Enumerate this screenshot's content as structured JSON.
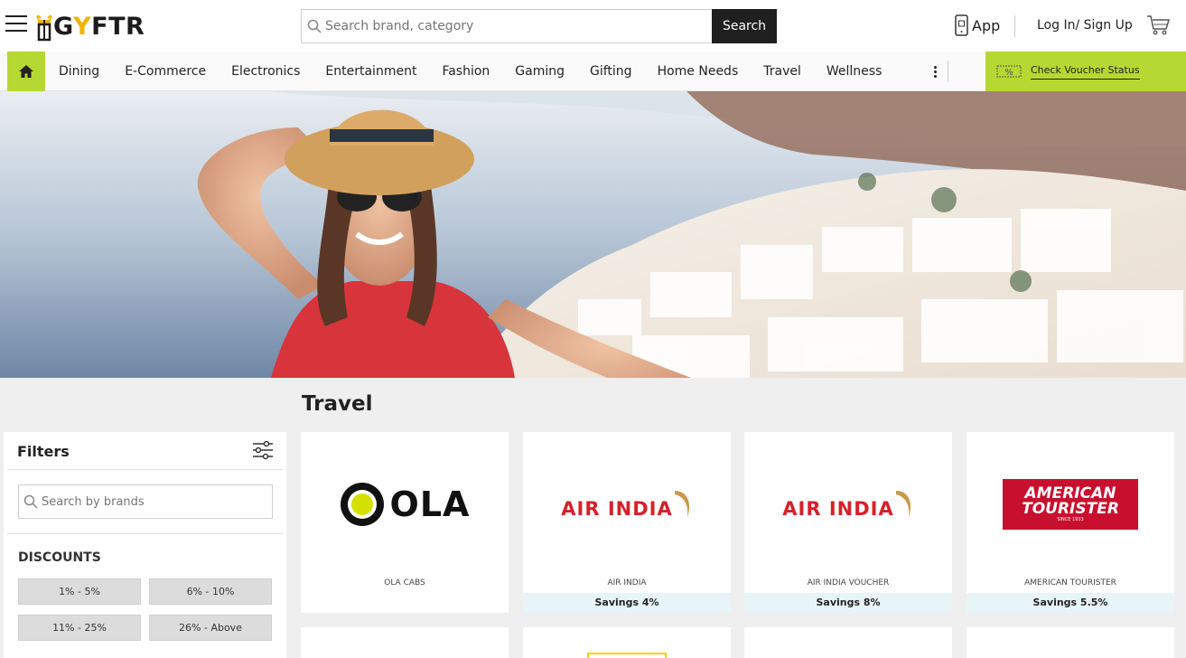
{
  "header": {
    "logo_text_left": "G",
    "logo_text_y": "Y",
    "logo_text_right": "FTR",
    "search_placeholder": "Search brand, category",
    "search_button": "Search",
    "app_label": "App",
    "login_label": "Log In/ Sign Up"
  },
  "nav": {
    "items": [
      "Dining",
      "E-Commerce",
      "Electronics",
      "Entertainment",
      "Fashion",
      "Gaming",
      "Gifting",
      "Home Needs",
      "Travel",
      "Wellness"
    ],
    "voucher_label": "Check Voucher Status"
  },
  "page_title": "Travel",
  "filters": {
    "title": "Filters",
    "brand_search_placeholder": "Search by brands",
    "discounts_title": "DISCOUNTS",
    "discount_chips": [
      "1% - 5%",
      "6% - 10%",
      "11% - 25%",
      "26% - Above"
    ]
  },
  "products": [
    {
      "logo_text": "OLA",
      "name": "OLA CABS",
      "savings": ""
    },
    {
      "logo_text": "AIR INDIA",
      "name": "AIR INDIA",
      "savings": "Savings 4%"
    },
    {
      "logo_text": "AIR INDIA",
      "name": "AIR INDIA VOUCHER",
      "savings": "Savings 8%"
    },
    {
      "logo_text_top": "AMERICAN",
      "logo_text_bottom": "TOURISTER",
      "logo_subtext": "SINCE 1933",
      "name": "AMERICAN TOURISTER",
      "savings": "Savings 5.5%"
    }
  ],
  "colors": {
    "accent_green": "#b5d832",
    "air_india_red": "#d7202a",
    "american_tourister_red": "#c8102e",
    "savings_bg": "#e8f5f8",
    "search_button_bg": "#1f1f1f"
  },
  "icons": {
    "menu": "hamburger-icon",
    "search": "search-icon",
    "app": "mobile-phone-icon",
    "cart": "cart-icon",
    "home": "home-icon",
    "more": "more-vertical-icon",
    "voucher": "voucher-ticket-icon",
    "filters": "sliders-icon"
  }
}
